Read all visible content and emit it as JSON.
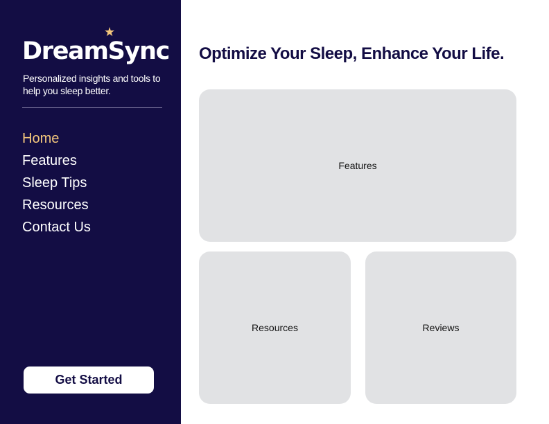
{
  "sidebar": {
    "logo": "DreamSync",
    "logo_icon": "star-icon",
    "tagline": "Personalized insights and tools to help you sleep better.",
    "nav": [
      {
        "label": "Home",
        "active": true
      },
      {
        "label": "Features",
        "active": false
      },
      {
        "label": "Sleep Tips",
        "active": false
      },
      {
        "label": "Resources",
        "active": false
      },
      {
        "label": "Contact Us",
        "active": false
      }
    ],
    "cta_label": "Get Started"
  },
  "main": {
    "headline": "Optimize Your Sleep, Enhance Your Life.",
    "cards": [
      {
        "label": "Features"
      },
      {
        "label": "Resources"
      },
      {
        "label": "Reviews"
      }
    ]
  },
  "colors": {
    "sidebar_bg": "#130d44",
    "accent": "#f4c77c",
    "card_bg": "#e1e2e4",
    "text_dark": "#130d44"
  }
}
